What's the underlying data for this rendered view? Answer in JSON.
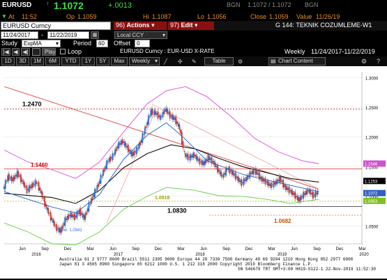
{
  "header": {
    "ticker": "EURUSD",
    "price": "1.1072",
    "change": "+.0013",
    "src": "BGN",
    "bidask": "1.1072 / 1.1072",
    "src2": "BGN",
    "at_label": "At",
    "at": "11:52",
    "op_label": "Op",
    "op": "1.1059",
    "hi_label": "Hi",
    "hi": "1.1087",
    "lo_label": "Lo",
    "lo": "1.1056",
    "close_label": "Close",
    "close": "1.1059",
    "value_label": "Value",
    "value": "11/26/19"
  },
  "toolbar": {
    "security": "EURUSD Curncy",
    "actions_num": "96)",
    "actions": "Actions",
    "edit_num": "97)",
    "edit": "Edit",
    "title": "G 144: TEKNIK COZUMLEME-W1",
    "date_from": "11/24/2017",
    "date_sep": "-",
    "date_to": "11/22/2019",
    "ccy": "Local CCY",
    "study_label": "Study",
    "study": "ExpMA",
    "period_label": "Period",
    "period": "60",
    "offset_label": "Offset",
    "offset": "0",
    "play": "Play",
    "loop": "Loop",
    "chart_name": "EURUSD Curncy : EUR-USD X-RATE",
    "freq": "Weekly",
    "range": "11/24/2017-11/22/2019",
    "periods": [
      "1D",
      "3D",
      "1M",
      "6M",
      "YTD",
      "1Y",
      "5Y",
      "Max"
    ],
    "freq_sel": "Weekly",
    "table": "Table",
    "content": "Chart Content"
  },
  "footer": {
    "line1": "Australia 61 2 9777 8600 Brazil 5511 2395 9000 Europe 44 20 7330 7500 Germany 49 69 9204 1210 Hong Kong 852 2977 6000",
    "line2": "Japan 81 3 4565 8900 Singapore 65 6212 1000 U.S. 1 212 318 2000 Copyright 2019 Bloomberg Finance L.P.",
    "line3": "SN 546679 TRT GMT+3:00 H819-5122-1 22-Nov-2019 11:52:30"
  },
  "chart_data": {
    "type": "line",
    "ylim": [
      1.02,
      1.31
    ],
    "y_ticks": [
      "1.3000",
      "1.2500",
      "1.2000",
      "1.1500",
      "1.1000",
      "1.0500"
    ],
    "x_ticks": [
      "Jun",
      "Sep",
      "Dec",
      "Mar",
      "Jun",
      "Sep",
      "Dec",
      "Mar",
      "Jun",
      "Sep",
      "Dec",
      "Mar",
      "Jun",
      "Sep",
      "Dec",
      "Mar"
    ],
    "year_ticks": [
      "2016",
      "2017",
      "2018",
      "2019",
      "2020"
    ],
    "annotations": [
      "1.2470",
      "1.1460",
      "1.0918",
      "1.0830",
      "1.0682",
      "Low: 1.0341"
    ],
    "right_labels": [
      {
        "text": "1.1546",
        "color": "#d050d0"
      },
      {
        "text": "1.1253",
        "color": "#000000"
      },
      {
        "text": "1.1072",
        "color": "#3060c0"
      },
      {
        "text": "1.0953",
        "color": "#80c020"
      }
    ],
    "levels": {
      "h1": 1.247,
      "h2": 1.146,
      "h3": 1.0918,
      "h4": 1.083,
      "h5": 1.0682
    },
    "price": [
      [
        0,
        1.112
      ],
      [
        4,
        1.133
      ],
      [
        8,
        1.128
      ],
      [
        12,
        1.139
      ],
      [
        16,
        1.125
      ],
      [
        20,
        1.11
      ],
      [
        24,
        1.118
      ],
      [
        28,
        1.124
      ],
      [
        32,
        1.105
      ],
      [
        36,
        1.082
      ],
      [
        40,
        1.064
      ],
      [
        44,
        1.048
      ],
      [
        48,
        1.041
      ],
      [
        52,
        1.06
      ],
      [
        56,
        1.069
      ],
      [
        60,
        1.065
      ],
      [
        64,
        1.075
      ],
      [
        68,
        1.063
      ],
      [
        72,
        1.085
      ],
      [
        76,
        1.103
      ],
      [
        80,
        1.121
      ],
      [
        84,
        1.142
      ],
      [
        88,
        1.16
      ],
      [
        92,
        1.168
      ],
      [
        96,
        1.185
      ],
      [
        100,
        1.193
      ],
      [
        104,
        1.182
      ],
      [
        108,
        1.17
      ],
      [
        112,
        1.178
      ],
      [
        116,
        1.195
      ],
      [
        120,
        1.22
      ],
      [
        124,
        1.243
      ],
      [
        128,
        1.24
      ],
      [
        132,
        1.232
      ],
      [
        136,
        1.247
      ],
      [
        140,
        1.236
      ],
      [
        144,
        1.23
      ],
      [
        148,
        1.215
      ],
      [
        152,
        1.17
      ],
      [
        156,
        1.165
      ],
      [
        160,
        1.17
      ],
      [
        164,
        1.16
      ],
      [
        168,
        1.155
      ],
      [
        172,
        1.165
      ],
      [
        176,
        1.158
      ],
      [
        180,
        1.145
      ],
      [
        184,
        1.133
      ],
      [
        188,
        1.147
      ],
      [
        192,
        1.14
      ],
      [
        196,
        1.131
      ],
      [
        200,
        1.122
      ],
      [
        204,
        1.13
      ],
      [
        208,
        1.14
      ],
      [
        212,
        1.142
      ],
      [
        216,
        1.13
      ],
      [
        220,
        1.125
      ],
      [
        224,
        1.118
      ],
      [
        228,
        1.122
      ],
      [
        232,
        1.13
      ],
      [
        236,
        1.116
      ],
      [
        240,
        1.11
      ],
      [
        244,
        1.103
      ],
      [
        248,
        1.094
      ],
      [
        252,
        1.103
      ],
      [
        256,
        1.11
      ],
      [
        260,
        1.101
      ],
      [
        264,
        1.107
      ]
    ],
    "ema_black": [
      [
        0,
        1.105
      ],
      [
        40,
        1.098
      ],
      [
        60,
        1.088
      ],
      [
        80,
        1.11
      ],
      [
        100,
        1.148
      ],
      [
        120,
        1.172
      ],
      [
        140,
        1.187
      ],
      [
        160,
        1.18
      ],
      [
        180,
        1.164
      ],
      [
        200,
        1.15
      ],
      [
        220,
        1.14
      ],
      [
        240,
        1.13
      ],
      [
        264,
        1.124
      ]
    ],
    "ema_blue": [
      [
        0,
        1.108
      ],
      [
        40,
        1.082
      ],
      [
        60,
        1.072
      ],
      [
        80,
        1.103
      ],
      [
        100,
        1.162
      ],
      [
        120,
        1.203
      ],
      [
        136,
        1.224
      ],
      [
        150,
        1.2
      ],
      [
        170,
        1.16
      ],
      [
        200,
        1.137
      ],
      [
        230,
        1.123
      ],
      [
        264,
        1.108
      ]
    ],
    "band_top": [
      [
        0,
        1.178
      ],
      [
        20,
        1.158
      ],
      [
        40,
        1.145
      ],
      [
        60,
        1.13
      ],
      [
        80,
        1.158
      ],
      [
        100,
        1.208
      ],
      [
        120,
        1.256
      ],
      [
        136,
        1.278
      ],
      [
        152,
        1.285
      ],
      [
        170,
        1.268
      ],
      [
        190,
        1.235
      ],
      [
        210,
        1.198
      ],
      [
        230,
        1.175
      ],
      [
        250,
        1.16
      ],
      [
        264,
        1.155
      ]
    ],
    "band_bot": [
      [
        0,
        1.055
      ],
      [
        20,
        1.04
      ],
      [
        40,
        1.02
      ],
      [
        60,
        1.018
      ],
      [
        80,
        1.04
      ],
      [
        100,
        1.078
      ],
      [
        120,
        1.1
      ],
      [
        136,
        1.115
      ],
      [
        160,
        1.11
      ],
      [
        180,
        1.101
      ],
      [
        200,
        1.1
      ],
      [
        220,
        1.095
      ],
      [
        240,
        1.088
      ],
      [
        264,
        1.095
      ]
    ],
    "trend": [
      [
        0,
        1.285
      ],
      [
        264,
        1.112
      ]
    ],
    "trend_pink": [
      [
        124,
        1.255
      ],
      [
        264,
        1.112
      ]
    ],
    "bounce": [
      [
        86,
        1.055
      ],
      [
        126,
        1.24
      ]
    ]
  }
}
